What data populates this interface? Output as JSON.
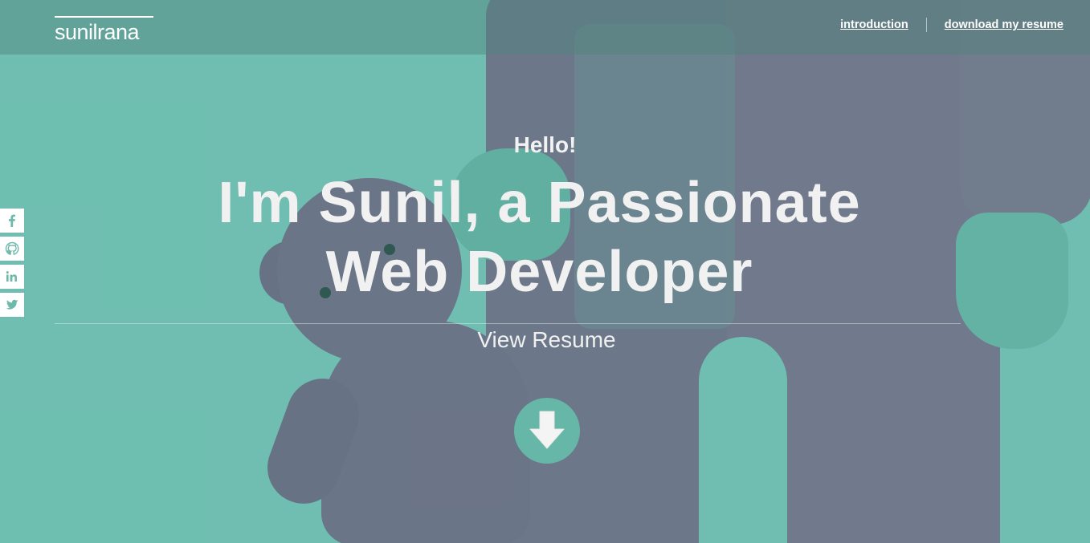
{
  "header": {
    "logo_light": "sunil",
    "logo_bold": "rana",
    "nav": [
      {
        "label": "introduction"
      },
      {
        "label": "download my resume"
      }
    ]
  },
  "social": [
    {
      "icon": "facebook-icon",
      "glyph": "f"
    },
    {
      "icon": "github-icon",
      "glyph": "github"
    },
    {
      "icon": "linkedin-icon",
      "glyph": "in"
    },
    {
      "icon": "twitter-icon",
      "glyph": "twitter"
    }
  ],
  "hero": {
    "greeting": "Hello!",
    "headline_line1": "I'm Sunil, a Passionate",
    "headline_line2": "Web Developer",
    "cta": "View Resume",
    "scroll_icon": "arrow-down-icon"
  },
  "colors": {
    "accent": "#72bfb2",
    "text": "#f2f2f2"
  }
}
